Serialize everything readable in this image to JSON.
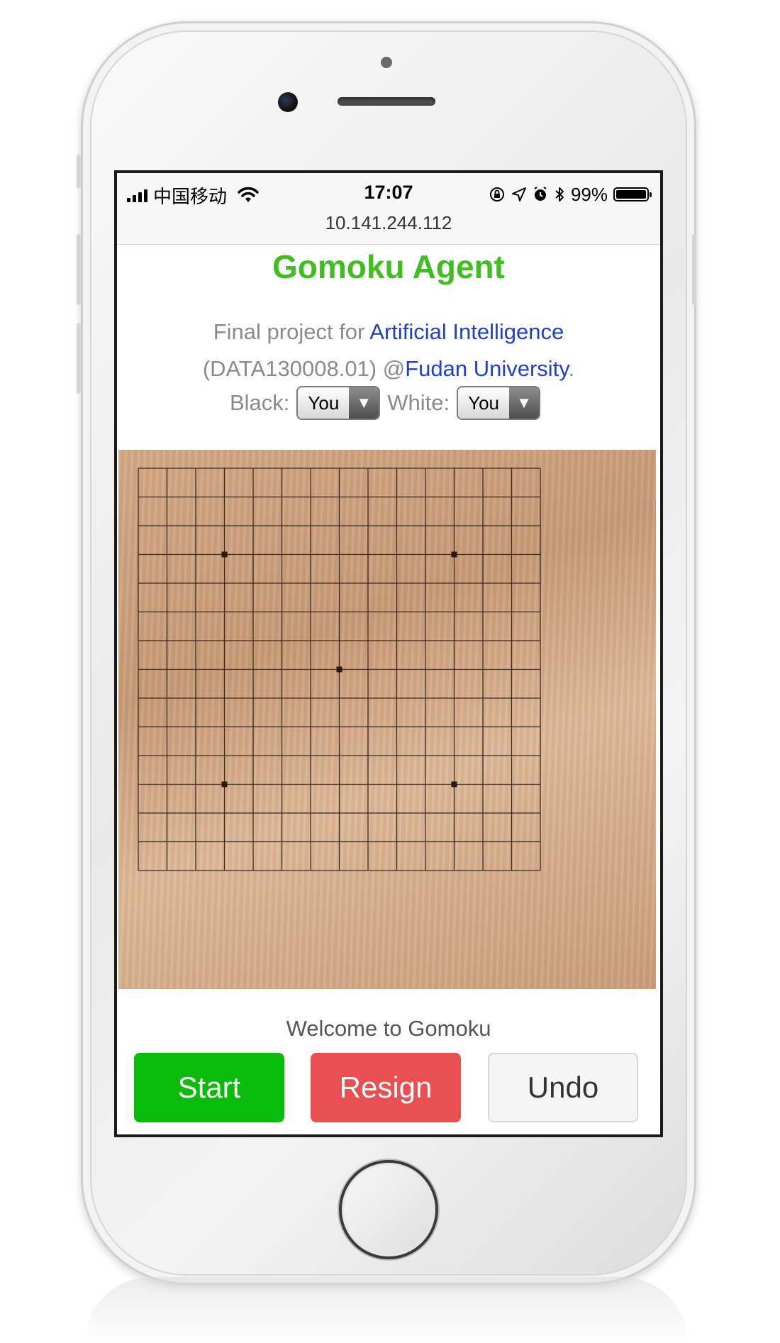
{
  "status_bar": {
    "carrier": "中国移动",
    "time": "17:07",
    "battery_percent": "99%",
    "battery_level": 0.99,
    "url": "10.141.244.112",
    "icons": [
      "signal-bars-icon",
      "wifi-icon",
      "orientation-lock-icon",
      "location-arrow-icon",
      "alarm-icon",
      "bluetooth-icon",
      "battery-icon"
    ]
  },
  "page": {
    "title": "Gomoku Agent",
    "subtitle": {
      "prefix": "Final project for ",
      "course_link": "Artificial Intelligence",
      "course_code": "(DATA130008.01) @",
      "university_link": "Fudan University",
      "suffix": "."
    },
    "players": {
      "black_label": "Black:",
      "black_value": "You",
      "white_label": "White:",
      "white_value": "You"
    }
  },
  "board": {
    "size": 15,
    "star_points": [
      [
        3,
        3
      ],
      [
        11,
        3
      ],
      [
        7,
        7
      ],
      [
        3,
        11
      ],
      [
        11,
        11
      ]
    ],
    "stones": []
  },
  "message": "Welcome to Gomoku",
  "buttons": {
    "start": "Start",
    "resign": "Resign",
    "undo": "Undo"
  },
  "colors": {
    "title_green": "#3fbf1f",
    "link_blue": "#1f3fd0",
    "start_green": "#0bbb0b",
    "resign_red": "#ea4f51",
    "board_wood": "#d2a886"
  }
}
